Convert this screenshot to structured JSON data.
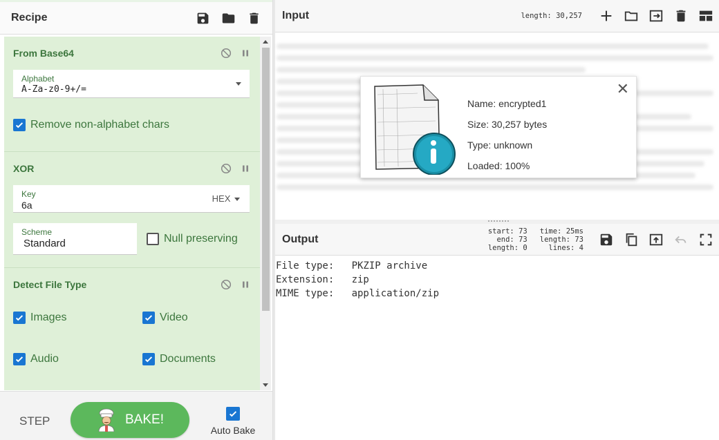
{
  "recipe": {
    "title": "Recipe",
    "operations": {
      "from_base64": {
        "title": "From Base64",
        "alphabet_label": "Alphabet",
        "alphabet_value": "A-Za-z0-9+/=",
        "remove_non_alpha_label": "Remove non-alphabet chars",
        "remove_non_alpha_checked": true
      },
      "xor": {
        "title": "XOR",
        "key_label": "Key",
        "key_value": "6a",
        "key_format": "HEX",
        "scheme_label": "Scheme",
        "scheme_value": "Standard",
        "null_preserving_label": "Null preserving",
        "null_preserving_checked": false
      },
      "detect_file_type": {
        "title": "Detect File Type",
        "images_label": "Images",
        "video_label": "Video",
        "audio_label": "Audio",
        "documents_label": "Documents"
      }
    },
    "step_label": "STEP",
    "bake_label": "BAKE!",
    "auto_bake_label": "Auto Bake",
    "auto_bake_checked": true
  },
  "input": {
    "title": "Input",
    "length_label": "length:",
    "length_value": "30,257",
    "file": {
      "name_label": "Name:",
      "name": "encrypted1",
      "size_label": "Size:",
      "size": "30,257 bytes",
      "type_label": "Type:",
      "type": "unknown",
      "loaded_label": "Loaded:",
      "loaded": "100%"
    }
  },
  "output": {
    "title": "Output",
    "stats": {
      "start_label": "start:",
      "start": "73",
      "end_label": "end:",
      "end": "73",
      "length_label": "length:",
      "length": "0",
      "time_label": "time:",
      "time": "25ms",
      "out_length_label": "length:",
      "out_length": "73",
      "lines_label": "lines:",
      "lines": "4"
    },
    "text": "File type:   PKZIP archive\nExtension:   zip\nMIME type:   application/zip"
  },
  "colors": {
    "op_background": "#dff0d8",
    "op_title": "#3c763d",
    "bake_button": "#5cb85c",
    "checkbox": "#1976d2"
  }
}
